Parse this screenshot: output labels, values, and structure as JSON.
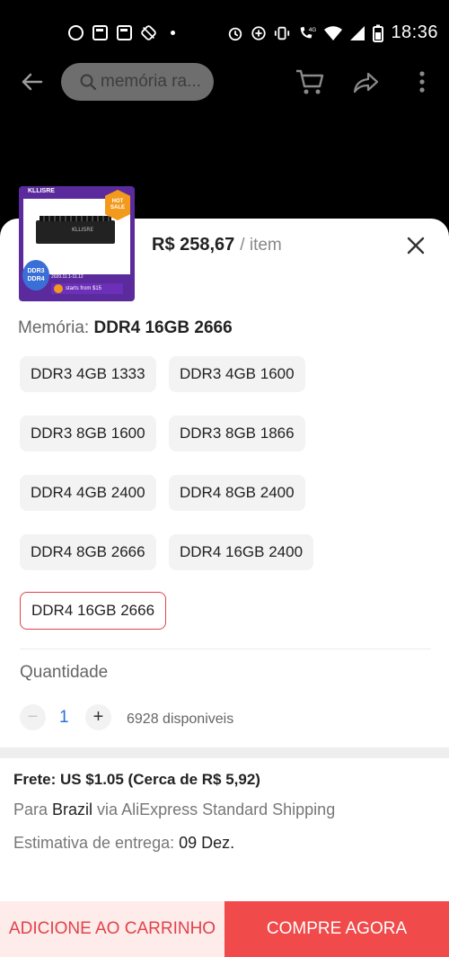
{
  "status_bar": {
    "time": "18:36",
    "network": "4G",
    "icons": [
      "circle-icon",
      "calendar-icon",
      "calendar-icon",
      "sync-off-icon",
      "dot-icon",
      "alarm-icon",
      "data-saver-icon",
      "vibrate-icon",
      "wifi-calling-icon",
      "wifi-icon",
      "signal-icon",
      "battery-icon"
    ]
  },
  "top_nav": {
    "back_icon": "arrow-left-icon",
    "search_text": "memória ra...",
    "search_icon": "search-icon",
    "cart_icon": "cart-icon",
    "share_icon": "share-icon",
    "more_icon": "more-vertical-icon"
  },
  "product": {
    "thumb_brand": "KLLISRE",
    "thumb_hot": "HOT SALE",
    "thumb_badge": "DDR3 DDR4",
    "thumb_ribbon": "starts from $15",
    "thumb_date": "2020.11.1-11.12",
    "price": "R$ 258,67",
    "price_unit": "/ item"
  },
  "variant": {
    "label": "Memória: ",
    "selected_value": "DDR4 16GB 2666",
    "options": [
      "DDR3 4GB 1333",
      "DDR3 4GB 1600",
      "DDR3 8GB 1600",
      "DDR3 8GB 1866",
      "DDR4 4GB 2400",
      "DDR4 8GB 2400",
      "DDR4 8GB 2666",
      "DDR4 16GB 2400",
      "DDR4 16GB 2666"
    ],
    "selected_index": 8
  },
  "quantity": {
    "label": "Quantidade",
    "minus": "−",
    "value": "1",
    "plus": "+",
    "available": "6928 disponiveis"
  },
  "shipping": {
    "title": "Frete: US $1.05 (Cerca de R$ 5,92)",
    "line1_prefix": "Para ",
    "line1_country": "Brazil",
    "line1_suffix": " via AliExpress Standard Shipping",
    "line2_prefix": "Estimativa de entrega: ",
    "line2_date": "09 Dez."
  },
  "actions": {
    "add_to_cart": "ADICIONE AO CARRINHO",
    "buy_now": "COMPRE AGORA"
  },
  "colors": {
    "accent_red": "#f04a4a",
    "selected_border": "#e2424a",
    "qty_blue": "#2a6fd6"
  }
}
